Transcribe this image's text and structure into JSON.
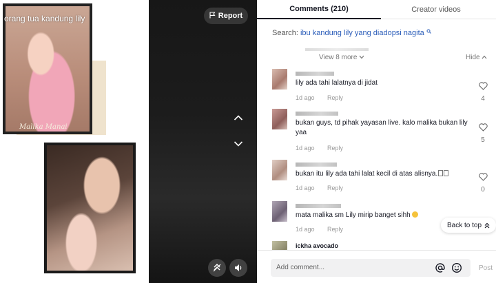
{
  "video": {
    "search_text": "orang tua kandung lily",
    "watermark": "Malika Manai",
    "report_label": "Report"
  },
  "tabs": {
    "comments": "Comments (210)",
    "creator": "Creator videos"
  },
  "search": {
    "prefix": "Search:",
    "query": "ibu kandung lily yang diadopsi nagita"
  },
  "thread": {
    "view_more": "View 8 more",
    "hide": "Hide"
  },
  "comments": [
    {
      "text": "lily ada tahi lalatnya di jidat",
      "time": "1d ago",
      "reply": "Reply",
      "likes": "4",
      "avatar_color": "#c9a79a"
    },
    {
      "text": "bukan guys, td pihak yayasan live. kalo malika bukan lily yaa",
      "time": "1d ago",
      "reply": "Reply",
      "likes": "5",
      "avatar_color": "#b38b88"
    },
    {
      "text": "bukan itu lily ada tahi lalat kecil di atas alisnya.",
      "time": "1d ago",
      "reply": "Reply",
      "likes": "0",
      "avatar_color": "#c8b0a6"
    },
    {
      "text": "mata malika sm Lily mirip banget sihh",
      "time": "1d ago",
      "reply": "Reply",
      "likes": "",
      "avatar_color": "#8e8494"
    },
    {
      "text": "",
      "time": "",
      "reply": "",
      "likes": "",
      "name": "ickha avocado",
      "avatar_color": "#a7a58d"
    }
  ],
  "back_to_top": "Back to top",
  "composer": {
    "placeholder": "Add comment...",
    "post": "Post"
  },
  "colors": {
    "link": "#2b5db9",
    "text": "#161823",
    "muted": "#999999"
  }
}
